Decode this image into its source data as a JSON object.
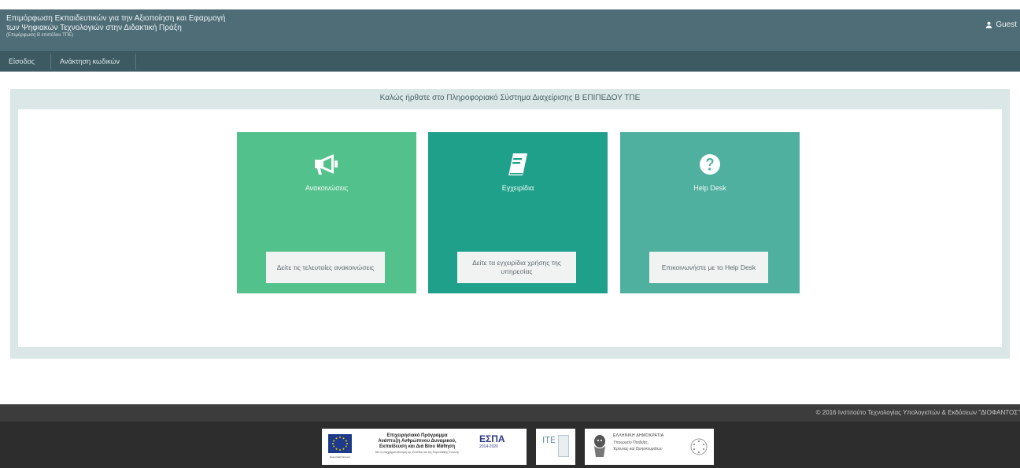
{
  "header": {
    "title_line1": "Επιμόρφωση Εκπαιδευτικών για την Αξιοποίηση και Εφαρμογή",
    "title_line2": "των Ψηφιακών Τεχνολογιών στην Διδακτική Πράξη",
    "version": "(Επιμόρφωση Β επιπέδου ΤΠΕ)",
    "user_label": "Guest",
    "user_icon": "user-icon"
  },
  "nav": {
    "items": [
      {
        "label": "Είσοδος"
      },
      {
        "label": "Ανάκτηση κωδικών"
      }
    ]
  },
  "panel": {
    "title": "Καλώς ήρθατε στο Πληροφοριακό Σύστημα Διαχείρισης Β ΕΠΙΠΕΔΟΥ ΤΠΕ"
  },
  "cards": [
    {
      "title": "Ανακοινώσεις",
      "button": "Δείτε τις τελευταίες ανακοινώσεις",
      "icon": "megaphone-icon",
      "color": "#52c18b"
    },
    {
      "title": "Εγχειρίδια",
      "button": "Δείτε τα εγχειρίδια χρήσης της υπηρεσίας",
      "icon": "book-icon",
      "color": "#1fa08b"
    },
    {
      "title": "Help Desk",
      "button": "Επικοινωνήστε με το Help Desk",
      "icon": "question-circle-icon",
      "color": "#4fb0a0"
    }
  ],
  "footer": {
    "copyright": "© 2016 Ινστιτούτο Τεχνολογίας Υπολογιστών & Εκδόσεων \"ΔΙΟΦΑΝΤΟΣ\"",
    "eu_caption": "Ευρωπαϊκή Ένωση",
    "op_title_1": "Επιχειρησιακό Πρόγραμμα",
    "op_title_2": "Ανάπτυξη Ανθρώπινου Δυναμικού,",
    "op_title_3": "Εκπαίδευση και Διά Βίου Μάθηση",
    "op_subtitle": "Με τη συγχρηματοδότηση της Ελλάδας και της Ευρωπαϊκής Ένωσης",
    "espa": "ΕΣΠΑ",
    "espa_years": "2014-2020",
    "ite": "ITE",
    "gr_1": "ΕΛΛΗΝΙΚΗ ΔΗΜΟΚΡΑΤΙΑ",
    "gr_2": "Υπουργείο Παιδείας,",
    "gr_3": "Έρευνας και Θρησκευμάτων"
  },
  "colors": {
    "header": "#4e6d77",
    "nav": "#3d5962",
    "panel": "#dbe6e7",
    "footer_top": "#3c3c3c",
    "footer_bottom": "#2d2d2d"
  }
}
